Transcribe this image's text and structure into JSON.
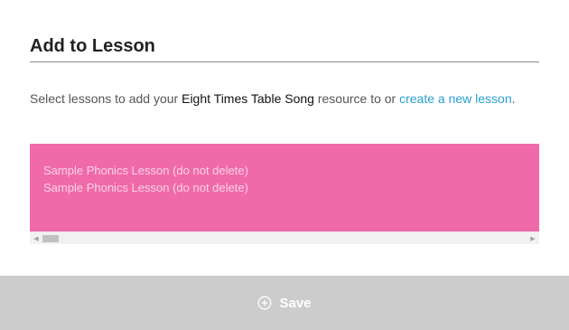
{
  "modal": {
    "title": "Add to Lesson",
    "description": {
      "prefix": "Select lessons to add your ",
      "resource_name": "Eight Times Table Song",
      "middle": " resource to or ",
      "link": "create a new lesson",
      "suffix": "."
    },
    "lessons": [
      "Sample Phonics Lesson (do not delete)",
      "Sample Phonics Lesson (do not delete)"
    ],
    "scrollbar": {
      "left_arrow_icon": "triangle-left-icon",
      "right_arrow_icon": "triangle-right-icon",
      "left_arrow": "◀",
      "right_arrow": "▶"
    },
    "save_button": {
      "icon": "plus-circle-icon",
      "label": "Save"
    },
    "colors": {
      "lesson_box": "#f06aaa",
      "link": "#2a9fd6",
      "save_bar": "#cccccc"
    }
  }
}
